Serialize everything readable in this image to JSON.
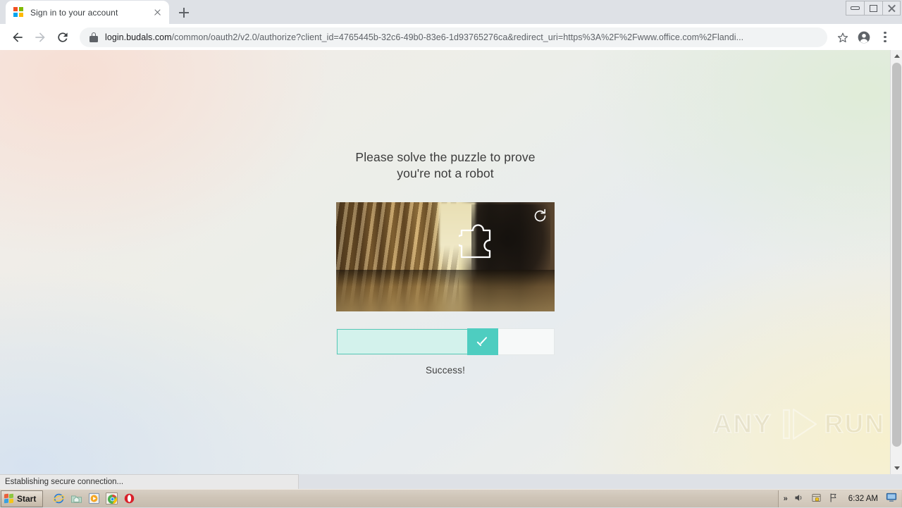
{
  "browser": {
    "tab": {
      "title": "Sign in to your account",
      "favicon": "microsoft-logo-icon",
      "close_icon": "close-icon"
    },
    "new_tab_icon": "plus-icon",
    "window_controls": {
      "minimize": "minimize-icon",
      "restore": "restore-icon",
      "close": "close-icon"
    },
    "toolbar": {
      "back_icon": "back-arrow-icon",
      "forward_icon": "forward-arrow-icon",
      "reload_icon": "reload-icon",
      "lock_icon": "lock-icon",
      "url_domain": "login.budals.com",
      "url_path": "/common/oauth2/v2.0/authorize?client_id=4765445b-32c6-49b0-83e6-1d93765276ca&redirect_uri=https%3A%2F%2Fwww.office.com%2Flandi...",
      "bookmark_icon": "star-icon",
      "profile_icon": "account-avatar-icon",
      "menu_icon": "three-dot-menu-icon"
    },
    "status_text": "Establishing secure connection...",
    "scrollbar": {
      "up_icon": "scroll-up-arrow-icon",
      "down_icon": "scroll-down-arrow-icon"
    }
  },
  "page": {
    "captcha": {
      "title": "Please solve the puzzle to prove\nyou're not a robot",
      "puzzle_image_alt": "wooden-bench-corridor-photo",
      "refresh_icon": "refresh-icon",
      "slider": {
        "handle_icon": "checkmark-icon",
        "fill_percent": 60
      },
      "status_message": "Success!"
    },
    "watermark": {
      "text_left": "ANY",
      "text_right": "RUN",
      "logo_icon": "play-button-logo-icon"
    },
    "colors": {
      "slider_handle": "#4ecdc0",
      "slider_fill": "#d3f2ec",
      "slider_border": "#57c9b7",
      "title_text": "#3b3b3b"
    }
  },
  "taskbar": {
    "start_label": "Start",
    "start_icon": "windows-flag-icon",
    "quick_launch": [
      {
        "name": "internet-explorer-icon"
      },
      {
        "name": "folder-home-icon"
      },
      {
        "name": "media-player-icon"
      },
      {
        "name": "chrome-icon",
        "active": true
      },
      {
        "name": "opera-icon"
      }
    ],
    "tray": {
      "chevron_icon": "show-hidden-icons-chevron",
      "volume_icon": "volume-icon",
      "security_icon": "security-shield-icon",
      "flag_icon": "flag-icon",
      "time": "6:32 AM",
      "monitor_icon": "monitor-icon"
    }
  }
}
